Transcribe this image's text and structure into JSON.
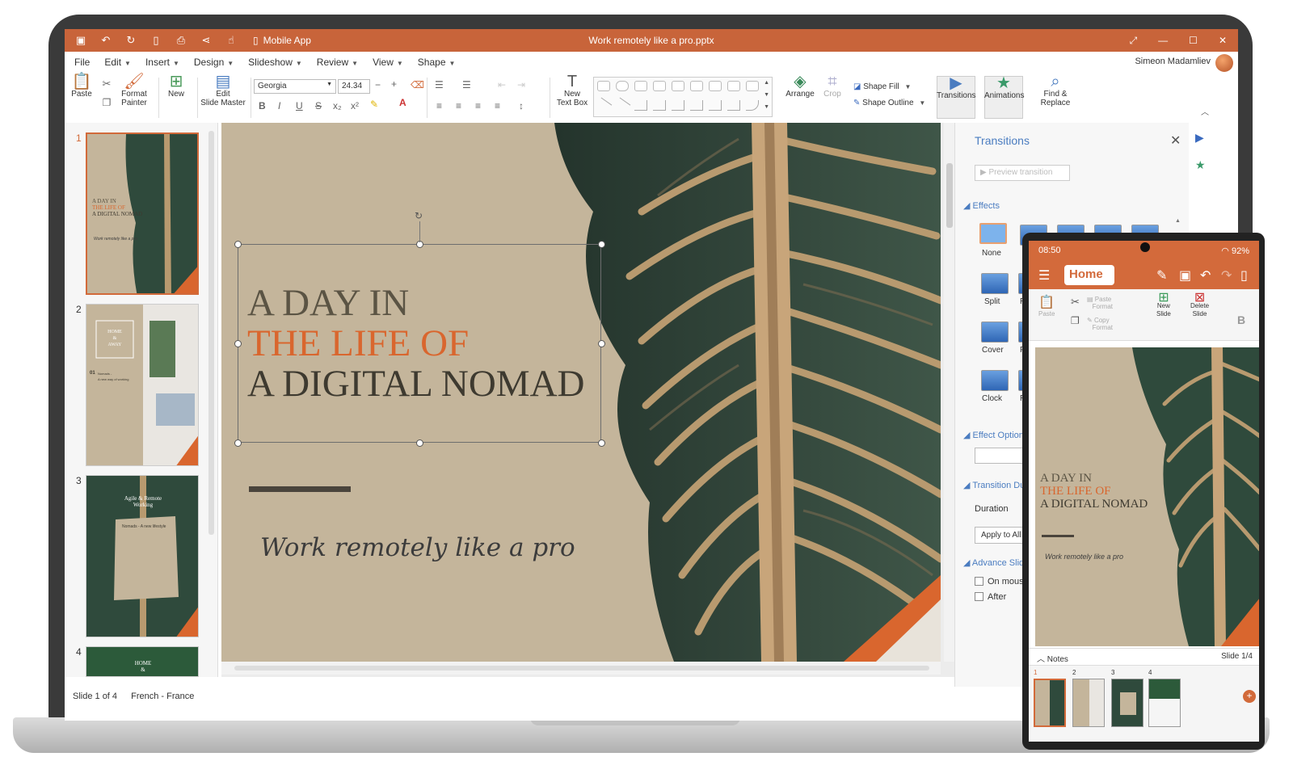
{
  "window": {
    "title": "Work remotely like a pro.pptx",
    "mobile_app_label": "Mobile App"
  },
  "menu": [
    "File",
    "Edit",
    "Insert",
    "Design",
    "Slideshow",
    "Review",
    "View",
    "Shape"
  ],
  "user": {
    "name": "Simeon Madamliev"
  },
  "ribbon": {
    "paste": "Paste",
    "format_painter_1": "Format",
    "format_painter_2": "Painter",
    "new": "New",
    "edit_master_1": "Edit",
    "edit_master_2": "Slide Master",
    "font": "Georgia",
    "font_size": "24.34",
    "new_textbox_1": "New",
    "new_textbox_2": "Text Box",
    "arrange": "Arrange",
    "crop": "Crop",
    "shape_fill": "Shape Fill",
    "shape_outline": "Shape Outline",
    "transitions": "Transitions",
    "animations": "Animations",
    "find_1": "Find &",
    "find_2": "Replace"
  },
  "thumbnails": {
    "numbers": [
      "1",
      "2",
      "3",
      "4"
    ],
    "s1_a": "A DAY IN",
    "s1_b": "THE LIFE OF",
    "s1_c": "A DIGITAL NOMAD",
    "s1_d": "Work remotely like a pro",
    "s2_a": "HOME",
    "s2_b": "&",
    "s2_c": "AWAY",
    "s2_d": "01",
    "s2_e": "Nomads -",
    "s2_f": "A new way of working",
    "s3_a": "Agile & Remote",
    "s3_b": "Working",
    "s3_c": "Nomads - A new lifestyle",
    "s4_a": "HOME",
    "s4_b": "&"
  },
  "slide": {
    "line1": "A DAY IN",
    "line2": "THE LIFE OF",
    "line3": "A DIGITAL NOMAD",
    "subtitle": "Work remotely like a pro"
  },
  "status": {
    "slide": "Slide 1 of 4",
    "language": "French - France"
  },
  "panel": {
    "title": "Transitions",
    "preview": "Preview transition",
    "effects": "Effects",
    "tiles": [
      "None",
      "Split",
      "Cover",
      "Clock"
    ],
    "tiles_cut": [
      "R",
      "F",
      "Ri"
    ],
    "effect_options": "Effect Options",
    "transition_duration": "Transition Du",
    "duration": "Duration",
    "apply_all": "Apply to All",
    "advance": "Advance Slide",
    "on_mouse": "On mouse c",
    "after": "After"
  },
  "phone": {
    "time": "08:50",
    "battery": "92%",
    "home": "Home",
    "paste": "Paste",
    "paste_format_1": "Paste",
    "paste_format_2": "Format",
    "copy_format_1": "Copy",
    "copy_format_2": "Format",
    "new_slide_1": "New",
    "new_slide_2": "Slide",
    "delete_slide_1": "Delete",
    "delete_slide_2": "Slide",
    "slide_line1": "A DAY IN",
    "slide_line2": "THE LIFE OF",
    "slide_line3": "A DIGITAL NOMAD",
    "slide_sub": "Work remotely like a pro",
    "notes": "Notes",
    "slide_count": "Slide 1/4",
    "thumb_numbers": [
      "1",
      "2",
      "3",
      "4"
    ]
  },
  "colors": {
    "accent": "#c8643a",
    "slide_bg": "#c4b59b",
    "title_orange": "#d9662e",
    "link_blue": "#4a7cc0"
  }
}
